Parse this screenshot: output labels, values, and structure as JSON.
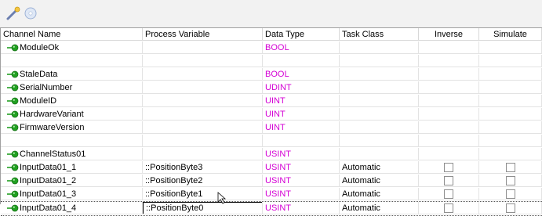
{
  "toolbar": {
    "buttons": [
      {
        "icon": "wand-icon"
      },
      {
        "icon": "disk-icon"
      }
    ]
  },
  "columns": [
    "Channel Name",
    "Process Variable",
    "Data Type",
    "Task Class",
    "Inverse",
    "Simulate"
  ],
  "rows": [
    {
      "channel": "ModuleOk",
      "variable": "",
      "type": "BOOL",
      "task": "",
      "checkbox": false
    },
    {
      "blank": true
    },
    {
      "channel": "StaleData",
      "variable": "",
      "type": "BOOL",
      "task": "",
      "checkbox": false
    },
    {
      "channel": "SerialNumber",
      "variable": "",
      "type": "UDINT",
      "task": "",
      "checkbox": false
    },
    {
      "channel": "ModuleID",
      "variable": "",
      "type": "UINT",
      "task": "",
      "checkbox": false
    },
    {
      "channel": "HardwareVariant",
      "variable": "",
      "type": "UINT",
      "task": "",
      "checkbox": false
    },
    {
      "channel": "FirmwareVersion",
      "variable": "",
      "type": "UINT",
      "task": "",
      "checkbox": false
    },
    {
      "blank": true
    },
    {
      "channel": "ChannelStatus01",
      "variable": "",
      "type": "USINT",
      "task": "",
      "checkbox": false
    },
    {
      "channel": "InputData01_1",
      "variable": "::PositionByte3",
      "type": "USINT",
      "task": "Automatic",
      "checkbox": true
    },
    {
      "channel": "InputData01_2",
      "variable": "::PositionByte2",
      "type": "USINT",
      "task": "Automatic",
      "checkbox": true
    },
    {
      "channel": "InputData01_3",
      "variable": "::PositionByte1",
      "type": "USINT",
      "task": "Automatic",
      "checkbox": true
    },
    {
      "channel": "InputData01_4",
      "variable": "::PositionByte0",
      "type": "USINT",
      "task": "Automatic",
      "checkbox": true,
      "editing": true
    }
  ],
  "colors": {
    "data_type": "#d400d4",
    "status_icon": "#22a022",
    "toolbar_bg": "#f2f2f2"
  }
}
